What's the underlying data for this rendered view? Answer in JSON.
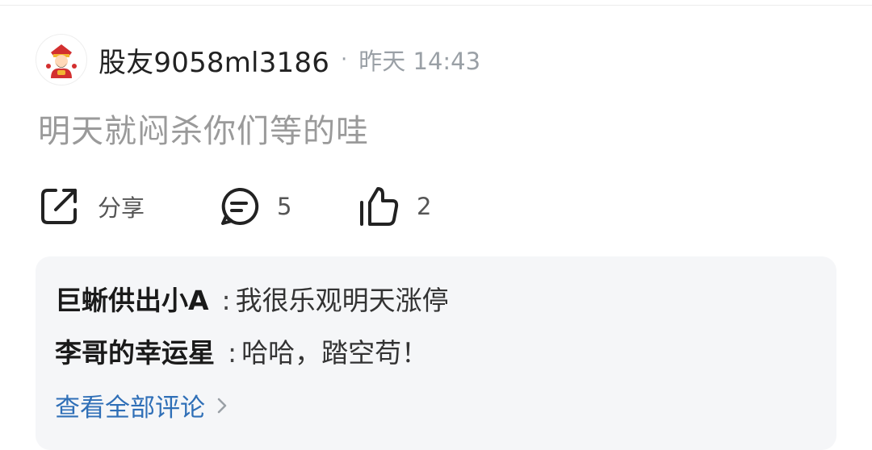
{
  "post": {
    "username": "股友9058ml3186",
    "separator": "·",
    "time": "昨天 14:43",
    "content": "明天就闷杀你们等的哇"
  },
  "actions": {
    "share_label": "分享",
    "comment_count": "5",
    "like_count": "2"
  },
  "comments": [
    {
      "author": "巨蜥供出小A",
      "sep": ":",
      "text": "我很乐观明天涨停"
    },
    {
      "author": "李哥的幸运星",
      "sep": ":",
      "text": "哈哈，踏空苟！"
    }
  ],
  "view_all_label": "查看全部评论",
  "icons": {
    "share": "share-icon",
    "comment": "comment-icon",
    "like": "thumbs-up-icon",
    "chevron": "chevron-right-icon"
  },
  "colors": {
    "link": "#2f6fb7",
    "muted": "#9aa0a6",
    "content": "#9a9a9a",
    "comment_bg": "#f5f6f8"
  }
}
